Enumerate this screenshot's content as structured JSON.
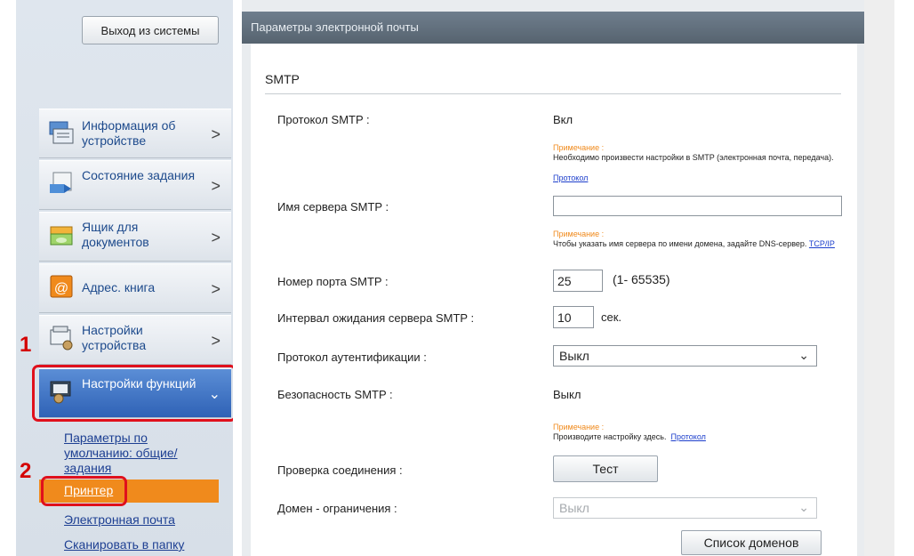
{
  "sidebar": {
    "logout_label": "Выход из системы",
    "items": [
      {
        "label": "Информация об устройстве",
        "icon": "device-info-icon"
      },
      {
        "label": "Состояние задания",
        "icon": "job-status-icon"
      },
      {
        "label": "Ящик для документов",
        "icon": "document-box-icon"
      },
      {
        "label": "Адрес. книга",
        "icon": "address-book-icon"
      },
      {
        "label": "Настройки устройства",
        "icon": "device-settings-icon"
      },
      {
        "label": "Настройки функций",
        "icon": "function-settings-icon"
      }
    ],
    "sub_items": [
      {
        "label": "Параметры по умолчанию: общие/задания"
      },
      {
        "label": "Принтер"
      },
      {
        "label": "Электронная почта"
      },
      {
        "label": "Сканировать в папку"
      }
    ],
    "callouts": [
      "1",
      "2"
    ],
    "chevron": ">",
    "chevron_down": "⌄"
  },
  "header": {
    "title": "Параметры электронной почты"
  },
  "section": {
    "title": "SMTP"
  },
  "form": {
    "smtp_protocol": {
      "label": "Протокол SMTP :",
      "value": "Вкл",
      "note_heading": "Примечание :",
      "note_text": "Необходимо произвести настройки в SMTP (электронная почта, передача).",
      "note_link": "Протокол"
    },
    "smtp_server": {
      "label": "Имя сервера SMTP :",
      "value": "",
      "note_heading": "Примечание :",
      "note_text": "Чтобы указать имя сервера по имени домена, задайте DNS-сервер.",
      "note_link": "TCP/IP"
    },
    "smtp_port": {
      "label": "Номер порта SMTP :",
      "value": "25",
      "range": "(1- 65535)"
    },
    "smtp_timeout": {
      "label": "Интервал ожидания сервера SMTP :",
      "value": "10",
      "unit": "сек."
    },
    "auth_protocol": {
      "label": "Протокол аутентификации :",
      "value": "Выкл"
    },
    "smtp_security": {
      "label": "Безопасность SMTP :",
      "value": "Выкл",
      "note_heading": "Примечание :",
      "note_text": "Производите настройку здесь.",
      "note_link": "Протокол"
    },
    "connection_test": {
      "label": "Проверка соединения :",
      "button": "Тест"
    },
    "domain_restriction": {
      "label": "Домен - ограничения :",
      "value": "Выкл"
    },
    "domain_list_button": "Список доменов"
  },
  "colors": {
    "accent_orange": "#f08a1c",
    "active_blue": "#3a6fc0",
    "callout_red": "#e0101c",
    "title_bar": "#5f6d7a"
  }
}
